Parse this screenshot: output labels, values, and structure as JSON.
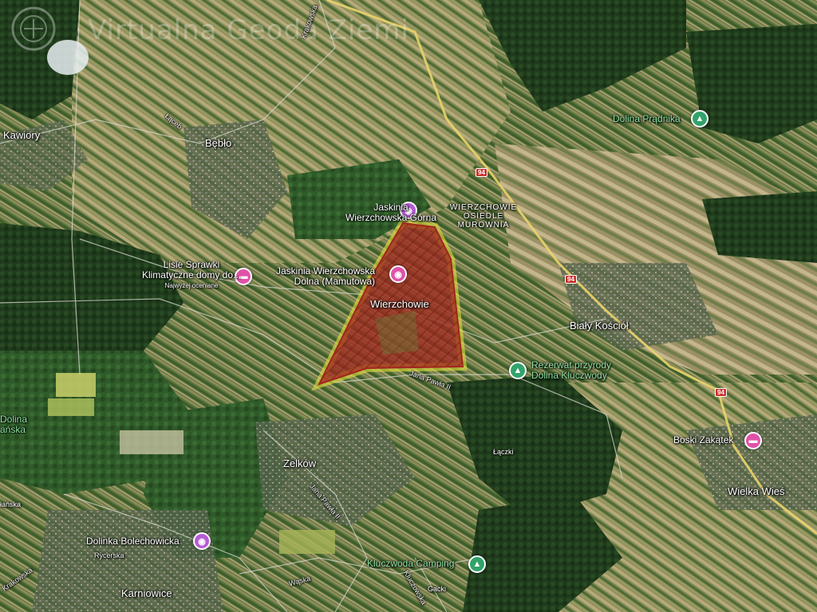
{
  "map": {
    "watermark": "Virtualna Geoda Ziemi",
    "colors": {
      "parcel_fill": "#a1261f",
      "parcel_edge": "#e4e23a",
      "main_road": "#e9d36a",
      "pin_attraction": "#b65bd6",
      "pin_lodging": "#e052a8",
      "pin_park": "#32a36b"
    },
    "places": [
      {
        "name": "Kawiory"
      },
      {
        "name": "Bębło"
      },
      {
        "name": "Wierzchowie"
      },
      {
        "name": "Zelków"
      },
      {
        "name": "Biały Kościół"
      },
      {
        "name": "Wielka Wieś"
      },
      {
        "name": "Karniowice"
      },
      {
        "name": "Łączki"
      },
      {
        "name": "Gacki"
      }
    ],
    "district": {
      "line1": "WIERZCHOWIE",
      "line2": "OSIEDLE",
      "line3": "MUROWNIA"
    },
    "partial_labels": {
      "dolina": "Dolina",
      "lanska": "ańska",
      "lanska2": "łańska"
    },
    "pois": [
      {
        "name": "Jaskinia Wierzchowska Górna",
        "line1": "Jaskinia",
        "line2": "Wierzchowska Górna",
        "icon": "camera-icon"
      },
      {
        "name": "Jaskinia Wierzchowska Dolna (Mamutowa)",
        "line1": "Jaskinia Wierzchowska",
        "line2": "Dolna (Mamutowa)",
        "icon": "camera-icon"
      },
      {
        "name": "Lisie Sprawki Klimatyczne domy do...",
        "line1": "Lisie Sprawki",
        "line2": "Klimatyczne domy do...",
        "note": "Najwyżej oceniane",
        "icon": "bed-icon"
      },
      {
        "name": "Dolina Prądnika",
        "icon": "tree-icon"
      },
      {
        "name": "Rezerwat przyrody Dolina Kluczwody",
        "line1": "Rezerwat przyrody",
        "line2": "Dolina Kluczwody",
        "icon": "tree-icon"
      },
      {
        "name": "Boski Zakątek",
        "icon": "bed-icon"
      },
      {
        "name": "Dolinka Bolechowicka",
        "icon": "camera-icon"
      },
      {
        "name": "Kluczwoda Camping",
        "icon": "tent-icon"
      }
    ],
    "roads": [
      {
        "name": "Krakowska"
      },
      {
        "name": "Łąceb"
      },
      {
        "name": "Jana Pawła II"
      },
      {
        "name": "Jana Pawła II"
      },
      {
        "name": "Rycerska"
      },
      {
        "name": "Krakowska"
      },
      {
        "name": "Wąska"
      },
      {
        "name": "Kluczowska"
      }
    ],
    "route_number": "94"
  }
}
